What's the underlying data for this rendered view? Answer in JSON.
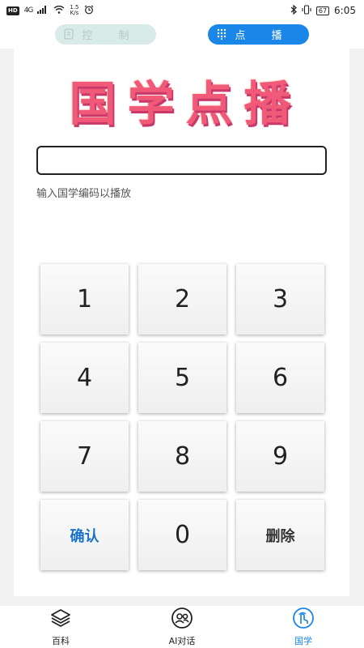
{
  "status_bar": {
    "hd": "HD",
    "network": "4G",
    "speed_value": "1.5",
    "speed_unit": "K/s",
    "battery": "67",
    "time": "6:05"
  },
  "top_segments": {
    "control_label": "控 制",
    "play_label": "点 播"
  },
  "logo_text": [
    "国",
    "学",
    "点",
    "播"
  ],
  "code_input": {
    "value": "",
    "placeholder": ""
  },
  "hint": "输入国学编码以播放",
  "keypad": {
    "keys": [
      "1",
      "2",
      "3",
      "4",
      "5",
      "6",
      "7",
      "8",
      "9"
    ],
    "confirm": "确认",
    "zero": "0",
    "delete": "删除"
  },
  "bottom_nav": {
    "items": [
      {
        "label": "百科",
        "icon": "layers-icon"
      },
      {
        "label": "AI对话",
        "icon": "chat-people-icon"
      },
      {
        "label": "国学",
        "icon": "touch-icon"
      }
    ]
  },
  "colors": {
    "accent": "#1a86e8",
    "logo": "#f05a78",
    "confirm": "#1a72c8"
  }
}
